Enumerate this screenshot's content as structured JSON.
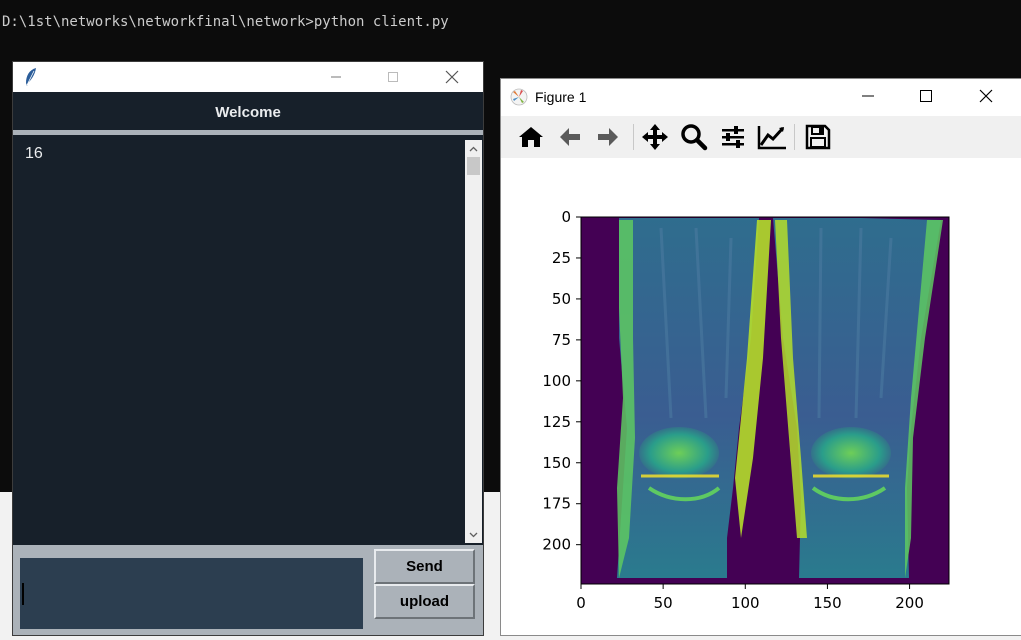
{
  "console": {
    "prompt_line": "D:\\1st\\networks\\networkfinal\\network>python client.py"
  },
  "chat_window": {
    "icon": "feather-icon",
    "header": "Welcome",
    "messages": "16",
    "input_value": "",
    "send_label": "Send",
    "upload_label": "upload"
  },
  "figure_window": {
    "title": "Figure 1",
    "toolbar": [
      "home-icon",
      "back-icon",
      "forward-icon",
      "pan-icon",
      "zoom-icon",
      "configure-subplots-icon",
      "edit-axis-icon",
      "save-icon"
    ]
  },
  "chart_data": {
    "type": "heatmap",
    "title": "",
    "xlabel": "",
    "ylabel": "",
    "x_ticks": [
      "0",
      "50",
      "100",
      "150",
      "200"
    ],
    "y_ticks": [
      "0",
      "25",
      "50",
      "75",
      "100",
      "125",
      "150",
      "175",
      "200"
    ],
    "xlim": [
      0,
      224
    ],
    "ylim": [
      224,
      0
    ],
    "colormap": "viridis",
    "content": "MRI coronal image of two knees"
  },
  "colors": {
    "console_bg": "#0c0c0c",
    "chat_bg": "#17202a",
    "chat_bottom": "#abb2b9",
    "input_bg": "#2c3e50",
    "viridis_dark": "#440154",
    "viridis_yellow": "#fde725"
  }
}
